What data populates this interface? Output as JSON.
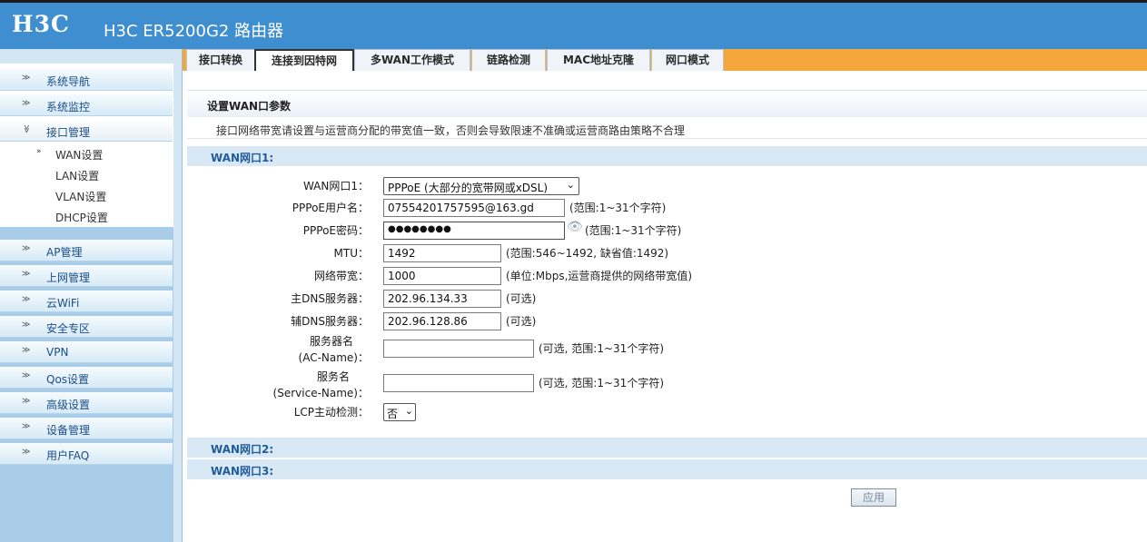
{
  "header": {
    "logo": "H3C",
    "model": "H3C ER5200G2 路由器"
  },
  "sidebar": {
    "items_top": [
      {
        "label": "系统导航"
      },
      {
        "label": "系统监控"
      },
      {
        "label": "接口管理"
      }
    ],
    "sub_items": [
      {
        "label": "WAN设置"
      },
      {
        "label": "LAN设置"
      },
      {
        "label": "VLAN设置"
      },
      {
        "label": "DHCP设置"
      }
    ],
    "items_bottom": [
      {
        "label": "AP管理"
      },
      {
        "label": "上网管理"
      },
      {
        "label": "云WiFi"
      },
      {
        "label": "安全专区"
      },
      {
        "label": "VPN"
      },
      {
        "label": "Qos设置"
      },
      {
        "label": "高级设置"
      },
      {
        "label": "设备管理"
      },
      {
        "label": "用户FAQ"
      }
    ]
  },
  "tabs": [
    {
      "label": "接口转换"
    },
    {
      "label": "连接到因特网"
    },
    {
      "label": "多WAN工作模式"
    },
    {
      "label": "链路检测"
    },
    {
      "label": "MAC地址克隆"
    },
    {
      "label": "网口模式"
    }
  ],
  "main": {
    "section_title": "设置WAN口参数",
    "notice": "接口网络带宽请设置与运营商分配的带宽值一致，否则会导致限速不准确或运营商路由策略不合理",
    "group1": "WAN网口1:",
    "group2": "WAN网口2:",
    "group3": "WAN网口3:",
    "form": {
      "wan_mode_label": "WAN网口1：",
      "wan_mode_value": "PPPoE (大部分的宽带网或xDSL)",
      "user_label": "PPPoE用户名：",
      "user_value": "07554201757595@163.gd",
      "user_hint": "(范围:1~31个字符)",
      "pwd_label": "PPPoE密码：",
      "pwd_value": "●●●●●●●●",
      "pwd_hint": "(范围:1~31个字符)",
      "mtu_label": "MTU：",
      "mtu_value": "1492",
      "mtu_hint": "(范围:546~1492, 缺省值:1492)",
      "bw_label": "网络带宽：",
      "bw_value": "1000",
      "bw_hint": "(单位:Mbps,运营商提供的网络带宽值)",
      "dns1_label": "主DNS服务器：",
      "dns1_value": "202.96.134.33",
      "dns1_hint": "(可选)",
      "dns2_label": "辅DNS服务器：",
      "dns2_value": "202.96.128.86",
      "dns2_hint": "(可选)",
      "ac_label_1": "服务器名",
      "ac_label_2": "(AC-Name)：",
      "ac_value": "",
      "ac_hint": "(可选, 范围:1~31个字符)",
      "svc_label_1": "服务名",
      "svc_label_2": "(Service-Name)：",
      "svc_value": "",
      "svc_hint": "(可选, 范围:1~31个字符)",
      "lcp_label": "LCP主动检测：",
      "lcp_value": "否"
    },
    "apply_label": "应用"
  },
  "icons": {
    "nav_arrow": "≫",
    "nav_open_arrow": "≫",
    "sub_arrow": "»",
    "eye": "👁",
    "caret": "⌄"
  }
}
